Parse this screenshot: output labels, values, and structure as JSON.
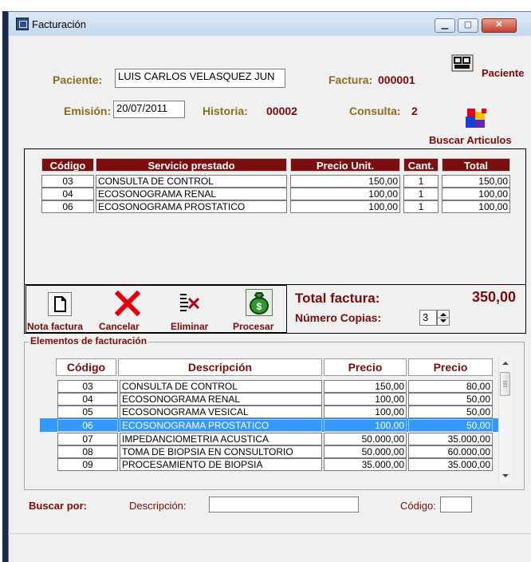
{
  "window": {
    "title": "Facturación",
    "controls": [
      "▁",
      "▢",
      "✕"
    ]
  },
  "header": {
    "paciente_label": "Paciente:",
    "paciente_value": "LUIS CARLOS VELASQUEZ JUN",
    "factura_label": "Factura:",
    "factura_value": "000001",
    "paciente_button": "Paciente",
    "emision_label": "Emisión:",
    "emision_value": "20/07/2011",
    "historia_label": "Historia:",
    "historia_value": "00002",
    "consulta_label": "Consulta:",
    "consulta_value": "2",
    "buscar_articulos": "Buscar Articulos"
  },
  "services": {
    "columns": [
      "Código",
      "Servicio prestado",
      "Precio Unit.",
      "Cant.",
      "Total"
    ],
    "rows": [
      {
        "codigo": "03",
        "servicio": "CONSULTA DE CONTROL",
        "precio": "150,00",
        "cant": "1",
        "total": "150,00"
      },
      {
        "codigo": "04",
        "servicio": "ECOSONOGRAMA RENAL",
        "precio": "100,00",
        "cant": "1",
        "total": "100,00"
      },
      {
        "codigo": "06",
        "servicio": "ECOSONOGRAMA PROSTATICO",
        "precio": "100,00",
        "cant": "1",
        "total": "100,00"
      }
    ]
  },
  "actions": {
    "nota_factura": "Nota factura",
    "cancelar": "Cancelar",
    "eliminar": "Eliminar",
    "procesar": "Procesar"
  },
  "totals": {
    "total_label": "Total factura:",
    "total_value": "350,00",
    "copias_label": "Número Copias:",
    "copias_value": "3"
  },
  "elements": {
    "legend": "Elementos de facturación",
    "columns": [
      "Código",
      "Descripción",
      "Precio",
      "Precio"
    ],
    "rows": [
      {
        "codigo": "03",
        "descripcion": "CONSULTA DE CONTROL",
        "precio1": "150,00",
        "precio2": "80,00"
      },
      {
        "codigo": "04",
        "descripcion": "ECOSONOGRAMA RENAL",
        "precio1": "100,00",
        "precio2": "50,00"
      },
      {
        "codigo": "05",
        "descripcion": "ECOSONOGRAMA VESICAL",
        "precio1": "100,00",
        "precio2": "50,00"
      },
      {
        "codigo": "06",
        "descripcion": "ECOSONOGRAMA PROSTATICO",
        "precio1": "100,00",
        "precio2": "50,00"
      },
      {
        "codigo": "07",
        "descripcion": "IMPEDANCIOMETRIA ACUSTICA",
        "precio1": "50.000,00",
        "precio2": "35.000,00"
      },
      {
        "codigo": "08",
        "descripcion": "TOMA DE BIOPSIA EN CONSULTORIO",
        "precio1": "50.000,00",
        "precio2": "60.000,00"
      },
      {
        "codigo": "09",
        "descripcion": "PROCESAMIENTO DE BIOPSIA",
        "precio1": "35.000,00",
        "precio2": "35.000,00"
      }
    ],
    "selected_row": 3
  },
  "search": {
    "buscar_por": "Buscar por:",
    "descripcion_label": "Descripción:",
    "descripcion_value": "",
    "codigo_label": "Código:",
    "codigo_value": ""
  },
  "colors": {
    "maroon": "#7a0f0f",
    "olive": "#8a6d1e",
    "selection": "#3399ff"
  }
}
